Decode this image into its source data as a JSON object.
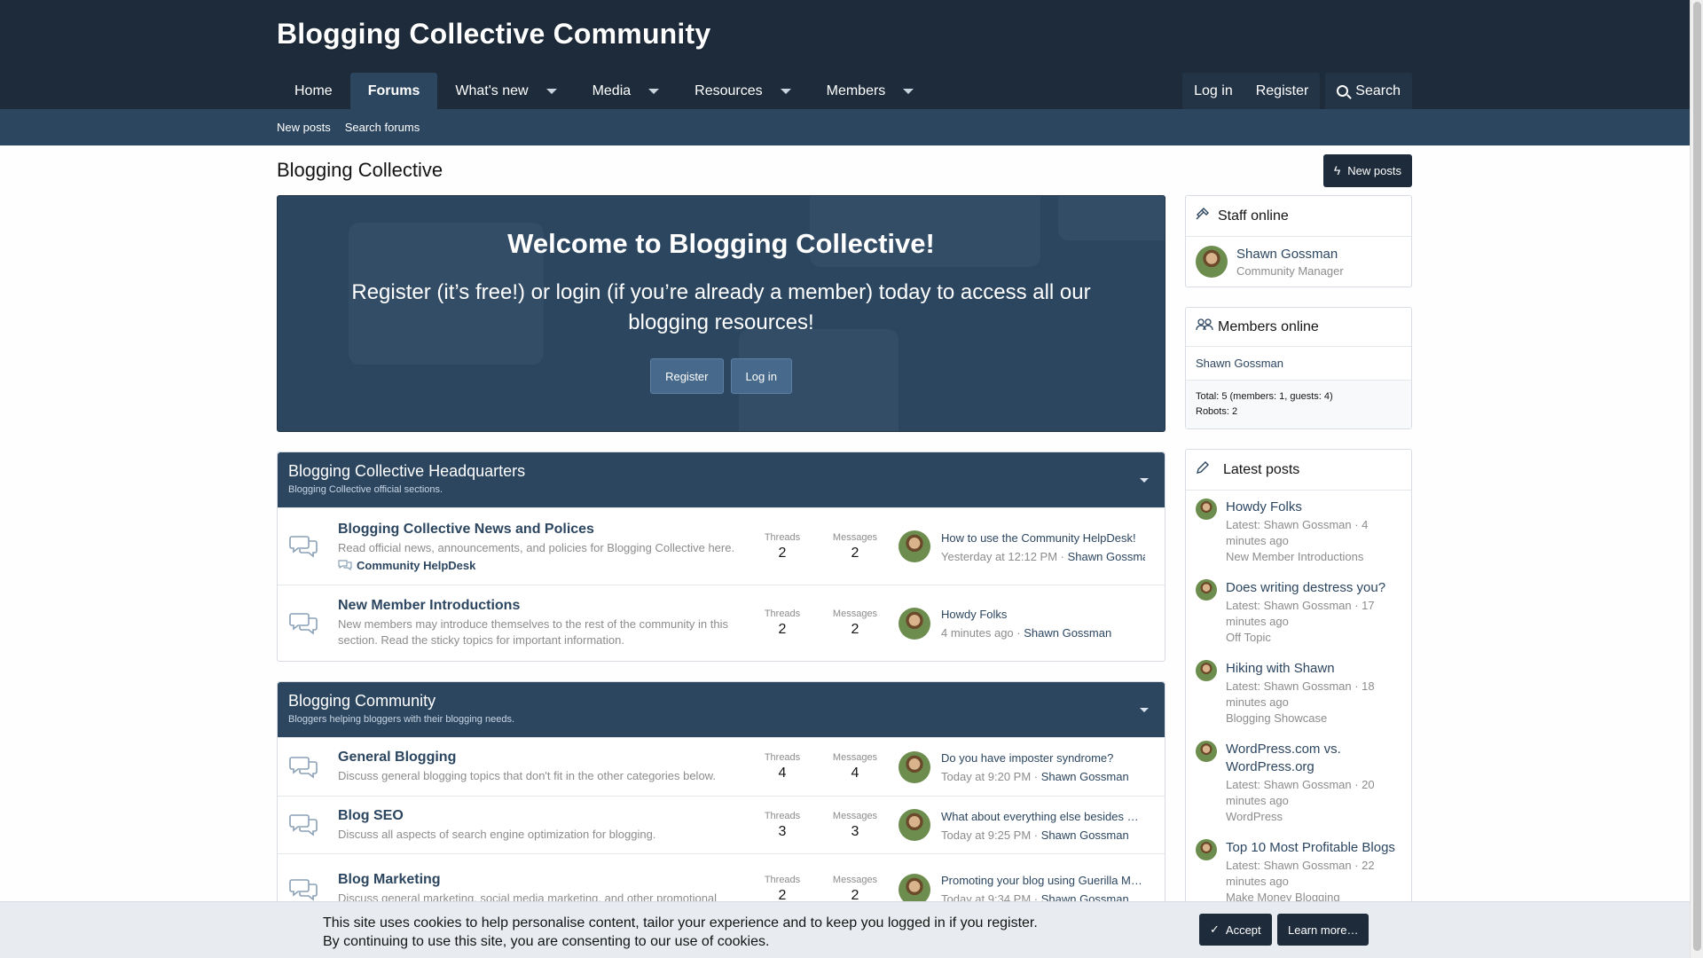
{
  "site": {
    "title": "Blogging Collective Community"
  },
  "nav": {
    "tabs": [
      {
        "label": "Home"
      },
      {
        "label": "Forums"
      },
      {
        "label": "What's new"
      },
      {
        "label": "Media"
      },
      {
        "label": "Resources"
      },
      {
        "label": "Members"
      }
    ],
    "login": "Log in",
    "register": "Register",
    "search": "Search"
  },
  "subnav": {
    "new_posts": "New posts",
    "search_forums": "Search forums"
  },
  "page": {
    "title": "Blogging Collective",
    "new_posts_button": "New posts"
  },
  "welcome": {
    "heading": "Welcome to Blogging Collective!",
    "text": "Register (it’s free!) or login (if you’re already a member) today to access all our blogging resources!",
    "register": "Register",
    "login": "Log in"
  },
  "categories": [
    {
      "title": "Blogging Collective Headquarters",
      "desc": "Blogging Collective official sections.",
      "nodes": [
        {
          "title": "Blogging Collective News and Polices",
          "desc": "Read official news, announcements, and policies for Blogging Collective here.",
          "sub": "Community HelpDesk",
          "threads_label": "Threads",
          "threads": "2",
          "messages_label": "Messages",
          "messages": "2",
          "last_title": "How to use the Community HelpDesk!",
          "last_time": "Yesterday at 12:12 PM",
          "last_user": "Shawn Gossman"
        },
        {
          "title": "New Member Introductions",
          "desc": "New members may introduce themselves to the rest of the community in this section. Read the sticky topics for important information.",
          "threads_label": "Threads",
          "threads": "2",
          "messages_label": "Messages",
          "messages": "2",
          "last_title": "Howdy Folks",
          "last_time": "4 minutes ago",
          "last_user": "Shawn Gossman"
        }
      ]
    },
    {
      "title": "Blogging Community",
      "desc": "Bloggers helping bloggers with their blogging needs.",
      "nodes": [
        {
          "title": "General Blogging",
          "desc": "Discuss general blogging topics that don't fit in the other categories below.",
          "threads_label": "Threads",
          "threads": "4",
          "messages_label": "Messages",
          "messages": "4",
          "last_title": "Do you have imposter syndrome?",
          "last_time": "Today at 9:20 PM",
          "last_user": "Shawn Gossman"
        },
        {
          "title": "Blog SEO",
          "desc": "Discuss all aspects of search engine optimization for blogging.",
          "threads_label": "Threads",
          "threads": "3",
          "messages_label": "Messages",
          "messages": "3",
          "last_title": "What about everything else besides …",
          "last_time": "Today at 9:25 PM",
          "last_user": "Shawn Gossman"
        },
        {
          "title": "Blog Marketing",
          "desc": "Discuss general marketing, social media marketing, and other promotional",
          "threads_label": "Threads",
          "threads": "2",
          "messages_label": "Messages",
          "messages": "2",
          "last_title": "Promoting your blog using Guerilla M…",
          "last_time": "Today at 9:34 PM",
          "last_user": "Shawn Gossman"
        }
      ]
    }
  ],
  "sidebar": {
    "staff": {
      "title": "Staff online",
      "name": "Shawn Gossman",
      "role": "Community Manager"
    },
    "members": {
      "title": "Members online",
      "name": "Shawn Gossman",
      "total": "Total: 5 (members: 1, guests: 4)",
      "robots": "Robots: 2"
    },
    "latest": {
      "title": "Latest posts",
      "posts": [
        {
          "title": "Howdy Folks",
          "meta": "Latest: Shawn Gossman · 4 minutes ago",
          "forum": "New Member Introductions"
        },
        {
          "title": "Does writing destress you?",
          "meta": "Latest: Shawn Gossman · 17 minutes ago",
          "forum": "Off Topic"
        },
        {
          "title": "Hiking with Shawn",
          "meta": "Latest: Shawn Gossman · 18 minutes ago",
          "forum": "Blogging Showcase"
        },
        {
          "title": "WordPress.com vs. WordPress.org",
          "meta": "Latest: Shawn Gossman · 20 minutes ago",
          "forum": "WordPress"
        },
        {
          "title": "Top 10 Most Profitable Blogs",
          "meta": "Latest: Shawn Gossman · 22 minutes ago",
          "forum": "Make Money Blogging"
        }
      ]
    }
  },
  "cookie": {
    "line1": "This site uses cookies to help personalise content, tailor your experience and to keep you logged in if you register.",
    "line2": "By continuing to use this site, you are consenting to our use of cookies.",
    "accept": "Accept",
    "learn_more": "Learn more…"
  }
}
